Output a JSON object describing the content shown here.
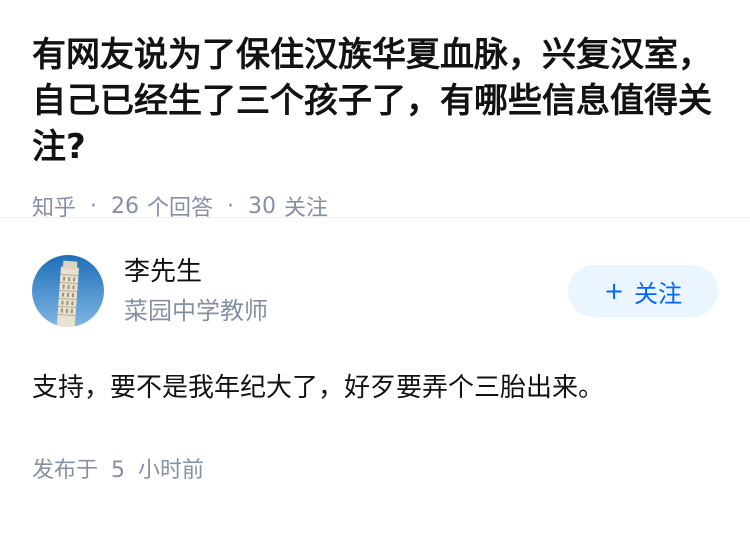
{
  "question": {
    "title": "有网友说为了保住汉族华夏血脉，兴复汉室，自己已经生了三个孩子了，有哪些信息值得关注?",
    "source": "知乎",
    "answer_count": "26",
    "answer_label": "个回答",
    "follow_count": "30",
    "follow_label": "关注"
  },
  "answer": {
    "author_name": "李先生",
    "author_desc": "菜园中学教师",
    "follow_button": "关注",
    "follow_icon": "plus-icon",
    "text": "支持，要不是我年纪大了，好歹要弄个三胎出来。",
    "time_prefix": "发布于",
    "time_value": "5",
    "time_suffix": "小时前"
  },
  "colors": {
    "accent": "#0066ff",
    "accent_bg": "#ebf5ff",
    "meta": "#8590a6",
    "text": "#121212"
  }
}
